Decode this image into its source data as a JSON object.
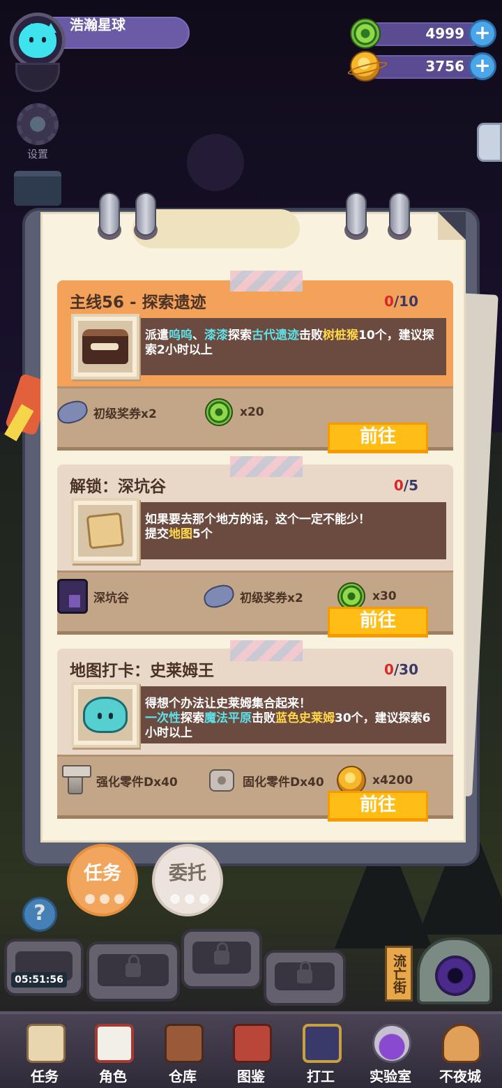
{
  "header": {
    "player_name": "浩瀚星球",
    "settings_label": "设置",
    "currencies": [
      {
        "name": "green-ring-coin",
        "value": "4999"
      },
      {
        "name": "gold-planet-coin",
        "value": "3756"
      }
    ]
  },
  "quests": [
    {
      "title": "主线56 - 探索遗迹",
      "progress_current": "0",
      "progress_total": "/10",
      "desc_parts": [
        "派遣",
        "呜呜",
        "、",
        "漆漆",
        "探索",
        "古代遗迹",
        "击败",
        "树桩猴",
        "10个，建议探索2小时以上"
      ],
      "rewards": [
        {
          "icon": "ticket-icon",
          "label": "初级奖券x2"
        },
        {
          "icon": "green-coin-icon",
          "label": "x20"
        }
      ],
      "button": "前往"
    },
    {
      "title": "解锁：深坑谷",
      "progress_current": "0",
      "progress_total": "/5",
      "desc_parts": [
        "如果要去那个地方的话，这个一定不能少！",
        "提交",
        "地图",
        "5个"
      ],
      "rewards": [
        {
          "icon": "place-icon",
          "label": "深坑谷"
        },
        {
          "icon": "ticket-icon",
          "label": "初级奖券x2"
        },
        {
          "icon": "green-coin-icon",
          "label": "x30"
        }
      ],
      "button": "前往"
    },
    {
      "title": "地图打卡：史莱姆王",
      "progress_current": "0",
      "progress_total": "/30",
      "desc_parts": [
        "得想个办法让史莱姆集合起来！",
        "一次性",
        "探索",
        "魔法平原",
        "击败",
        "蓝色史莱姆",
        "30个，建议探索6小时以上"
      ],
      "rewards": [
        {
          "icon": "bolt-icon",
          "label": "强化零件Dx40"
        },
        {
          "icon": "nut-icon",
          "label": "固化零件Dx40"
        },
        {
          "icon": "gold-coin-icon",
          "label": "x4200"
        }
      ],
      "button": "前往"
    }
  ],
  "paw_tabs": {
    "task": "任务",
    "entrust": "委托"
  },
  "scene": {
    "timer": "05:51:56",
    "exile_street": "流亡街",
    "help": "?"
  },
  "bottom_nav": [
    {
      "label": "任务",
      "icon": "task-board-icon"
    },
    {
      "label": "角色",
      "icon": "character-icon"
    },
    {
      "label": "仓库",
      "icon": "warehouse-icon"
    },
    {
      "label": "图鉴",
      "icon": "book-icon"
    },
    {
      "label": "打工",
      "icon": "work-icon"
    },
    {
      "label": "实验室",
      "icon": "lab-icon"
    },
    {
      "label": "不夜城",
      "icon": "night-city-icon"
    }
  ],
  "colors": {
    "accent_orange": "#f4a15a",
    "button_yellow": "#ffbd16",
    "highlight_cyan": "#5ee2ea",
    "highlight_yellow": "#ffd84a",
    "progress_red": "#d62a2a"
  }
}
